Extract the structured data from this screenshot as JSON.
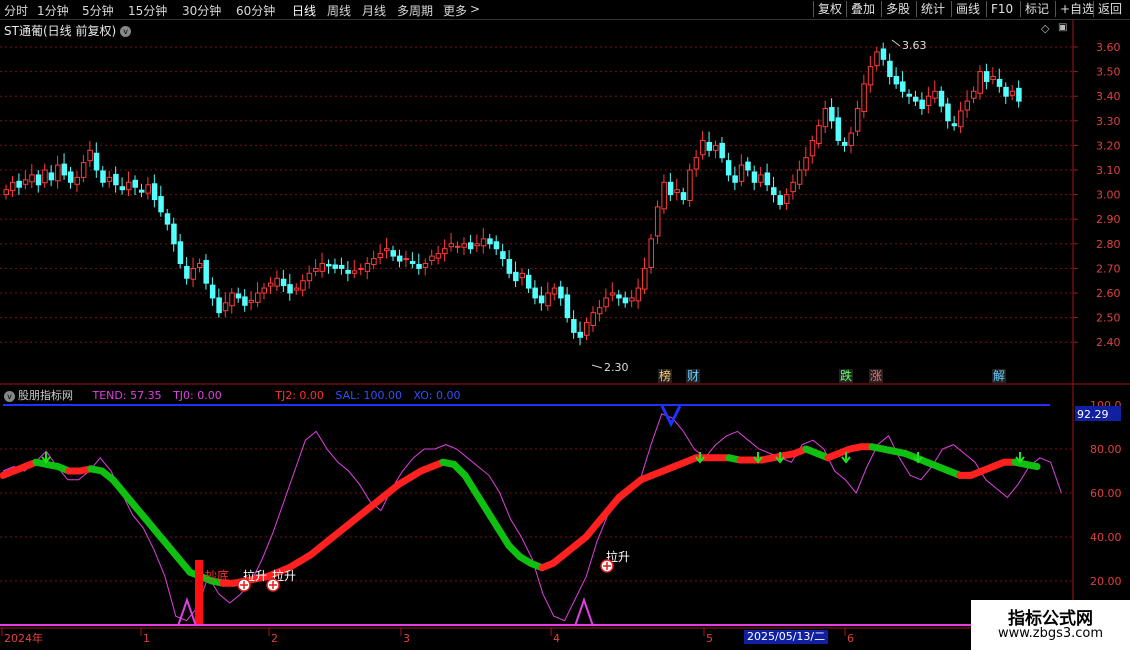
{
  "toolbar": {
    "timeframes": [
      "分时",
      "1分钟",
      "5分钟",
      "15分钟",
      "30分钟",
      "60分钟",
      "日线",
      "周线",
      "月线",
      "多周期",
      "更多"
    ],
    "more_arrow": ">",
    "right_buttons": [
      "复权",
      "叠加",
      "多股",
      "统计",
      "画线",
      "F10",
      "标记",
      "+自选",
      "返回"
    ]
  },
  "stock": {
    "title": "ST通葡(日线 前复权)",
    "dropdown": "v"
  },
  "price_axis": {
    "labels": [
      "3.60",
      "3.50",
      "3.40",
      "3.30",
      "3.20",
      "3.10",
      "3.00",
      "2.90",
      "2.80",
      "2.70",
      "2.60",
      "2.50",
      "2.40"
    ],
    "high_label": "3.63",
    "low_label": "2.30"
  },
  "event_tags": [
    {
      "text": "榜",
      "color": "#ffcc66"
    },
    {
      "text": "财",
      "color": "#66ccff"
    },
    {
      "text": "跌",
      "color": "#66ff66"
    },
    {
      "text": "涨",
      "color": "#ff6666"
    },
    {
      "text": "解",
      "color": "#66ccff"
    }
  ],
  "indicator": {
    "name": "股朋指标网",
    "values": [
      {
        "text": "TEND: 57.35",
        "color": "#e040e0"
      },
      {
        "text": "TJ0: 0.00",
        "color": "#e040e0"
      },
      {
        "text": "TJ2: 0.00",
        "color": "#ff3030"
      },
      {
        "text": "SAL: 100.00",
        "color": "#3050ff"
      },
      {
        "text": "XO: 0.00",
        "color": "#3050ff"
      }
    ],
    "axis_labels": [
      "100.0",
      "80.00",
      "60.00",
      "40.00",
      "20.00"
    ],
    "current_value": "92.29",
    "signals": [
      "抄底",
      "拉升",
      "拉升",
      "拉升"
    ]
  },
  "time_axis": {
    "labels": [
      "2024年",
      "1",
      "2",
      "3",
      "4",
      "5",
      "6"
    ],
    "highlight": "2025/05/13/二"
  },
  "watermark": {
    "line1": "指标公式网",
    "line2": "www.zbgs3.com"
  },
  "colors": {
    "up": "#ff3b3b",
    "down": "#54ffff",
    "bull_band": "#ff2020",
    "bear_band": "#10c010",
    "tend": "#e040e0",
    "sal": "#2030ff"
  }
}
